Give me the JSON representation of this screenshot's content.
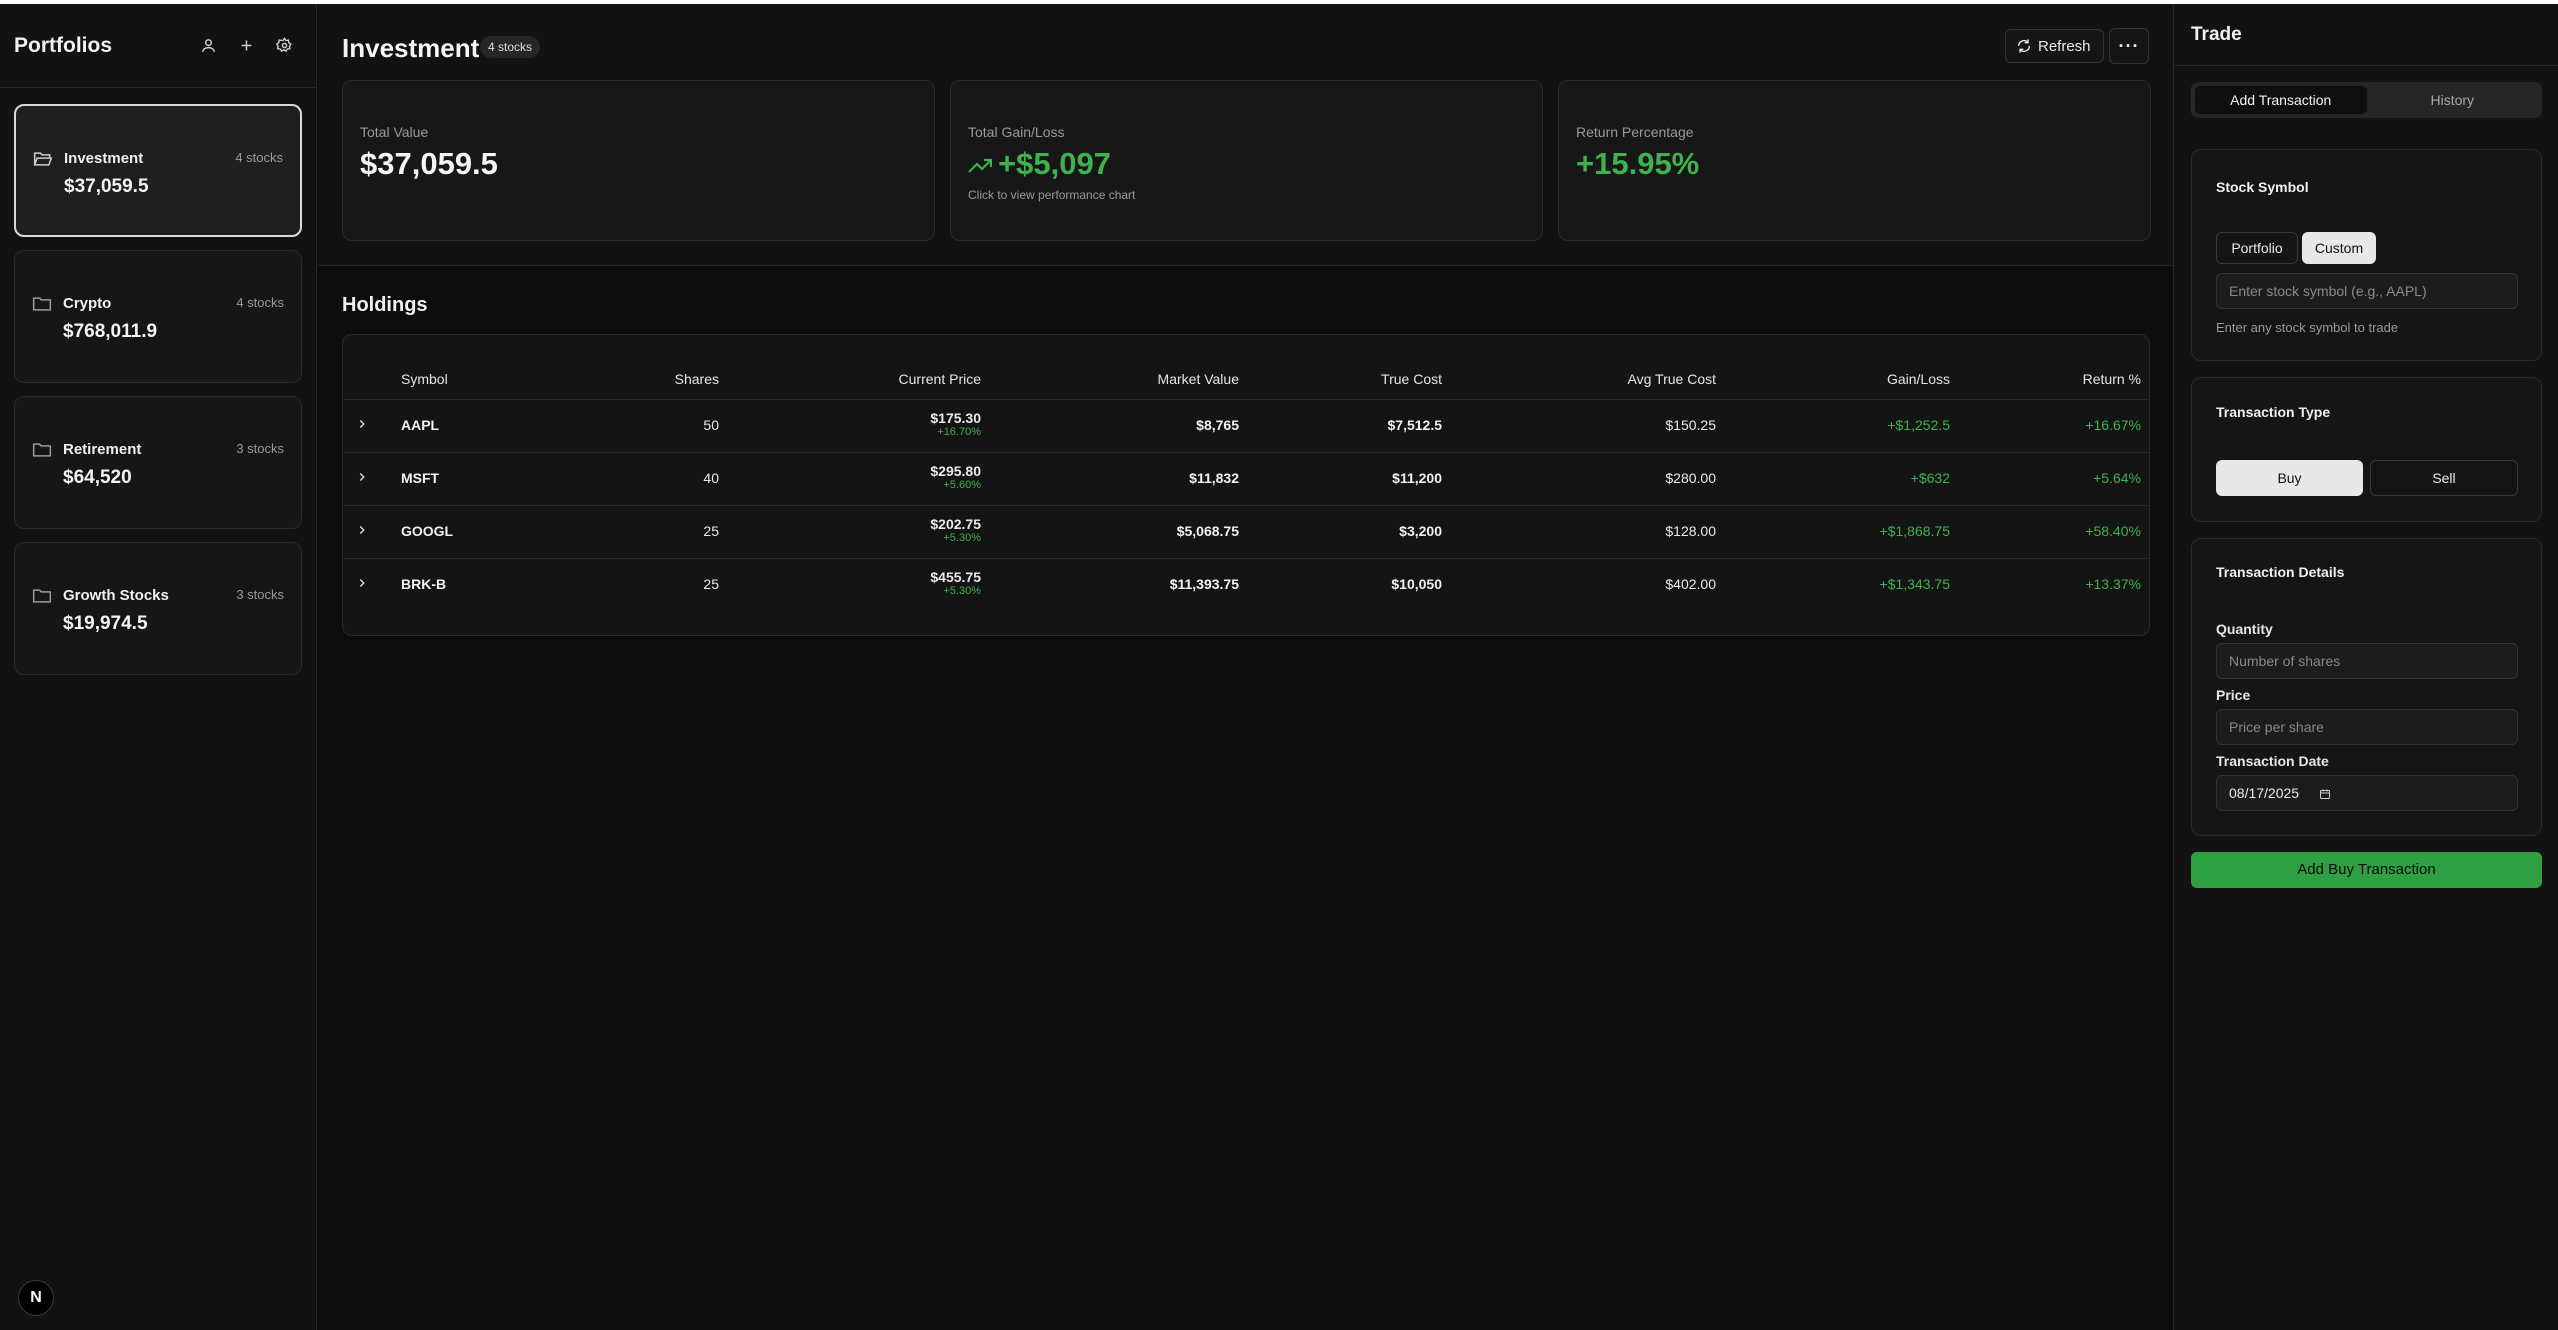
{
  "sidebar": {
    "title": "Portfolios",
    "portfolios": [
      {
        "name": "Investment",
        "count": "4 stocks",
        "value": "$37,059.5",
        "active": true
      },
      {
        "name": "Crypto",
        "count": "4 stocks",
        "value": "$768,011.9",
        "active": false
      },
      {
        "name": "Retirement",
        "count": "3 stocks",
        "value": "$64,520",
        "active": false
      },
      {
        "name": "Growth Stocks",
        "count": "3 stocks",
        "value": "$19,974.5",
        "active": false
      }
    ],
    "badge": "N"
  },
  "main": {
    "title": "Investment",
    "badge": "4 stocks",
    "refresh_label": "Refresh",
    "more_label": "···",
    "stats": {
      "total_value_label": "Total Value",
      "total_value": "$37,059.5",
      "gain_label": "Total Gain/Loss",
      "gain_value": "+$5,097",
      "gain_sub": "Click to view performance chart",
      "return_label": "Return Percentage",
      "return_value": "+15.95%"
    },
    "holdings": {
      "title": "Holdings",
      "columns": [
        "Symbol",
        "Shares",
        "Current Price",
        "Market Value",
        "True Cost",
        "Avg True Cost",
        "Gain/Loss",
        "Return %"
      ],
      "rows": [
        {
          "symbol": "AAPL",
          "shares": "50",
          "price": "$175.30",
          "change": "+16.70%",
          "market_value": "$8,765",
          "true_cost": "$7,512.5",
          "avg_cost": "$150.25",
          "gain": "+$1,252.5",
          "return": "+16.67%"
        },
        {
          "symbol": "MSFT",
          "shares": "40",
          "price": "$295.80",
          "change": "+5.60%",
          "market_value": "$11,832",
          "true_cost": "$11,200",
          "avg_cost": "$280.00",
          "gain": "+$632",
          "return": "+5.64%"
        },
        {
          "symbol": "GOOGL",
          "shares": "25",
          "price": "$202.75",
          "change": "+5.30%",
          "market_value": "$5,068.75",
          "true_cost": "$3,200",
          "avg_cost": "$128.00",
          "gain": "+$1,868.75",
          "return": "+58.40%"
        },
        {
          "symbol": "BRK-B",
          "shares": "25",
          "price": "$455.75",
          "change": "+5.30%",
          "market_value": "$11,393.75",
          "true_cost": "$10,050",
          "avg_cost": "$402.00",
          "gain": "+$1,343.75",
          "return": "+13.37%"
        }
      ]
    }
  },
  "trade": {
    "title": "Trade",
    "tabs": [
      "Add Transaction",
      "History"
    ],
    "stock_symbol": {
      "title": "Stock Symbol",
      "mode_portfolio": "Portfolio",
      "mode_custom": "Custom",
      "placeholder": "Enter stock symbol (e.g., AAPL)",
      "help": "Enter any stock symbol to trade"
    },
    "transaction_type": {
      "title": "Transaction Type",
      "buy": "Buy",
      "sell": "Sell"
    },
    "details": {
      "title": "Transaction Details",
      "quantity_label": "Quantity",
      "quantity_placeholder": "Number of shares",
      "price_label": "Price",
      "price_placeholder": "Price per share",
      "date_label": "Transaction Date",
      "date_value": "08/17/2025"
    },
    "submit_label": "Add Buy Transaction"
  },
  "colors": {
    "positive": "#3fb24f",
    "accent_button": "#2ea043"
  }
}
